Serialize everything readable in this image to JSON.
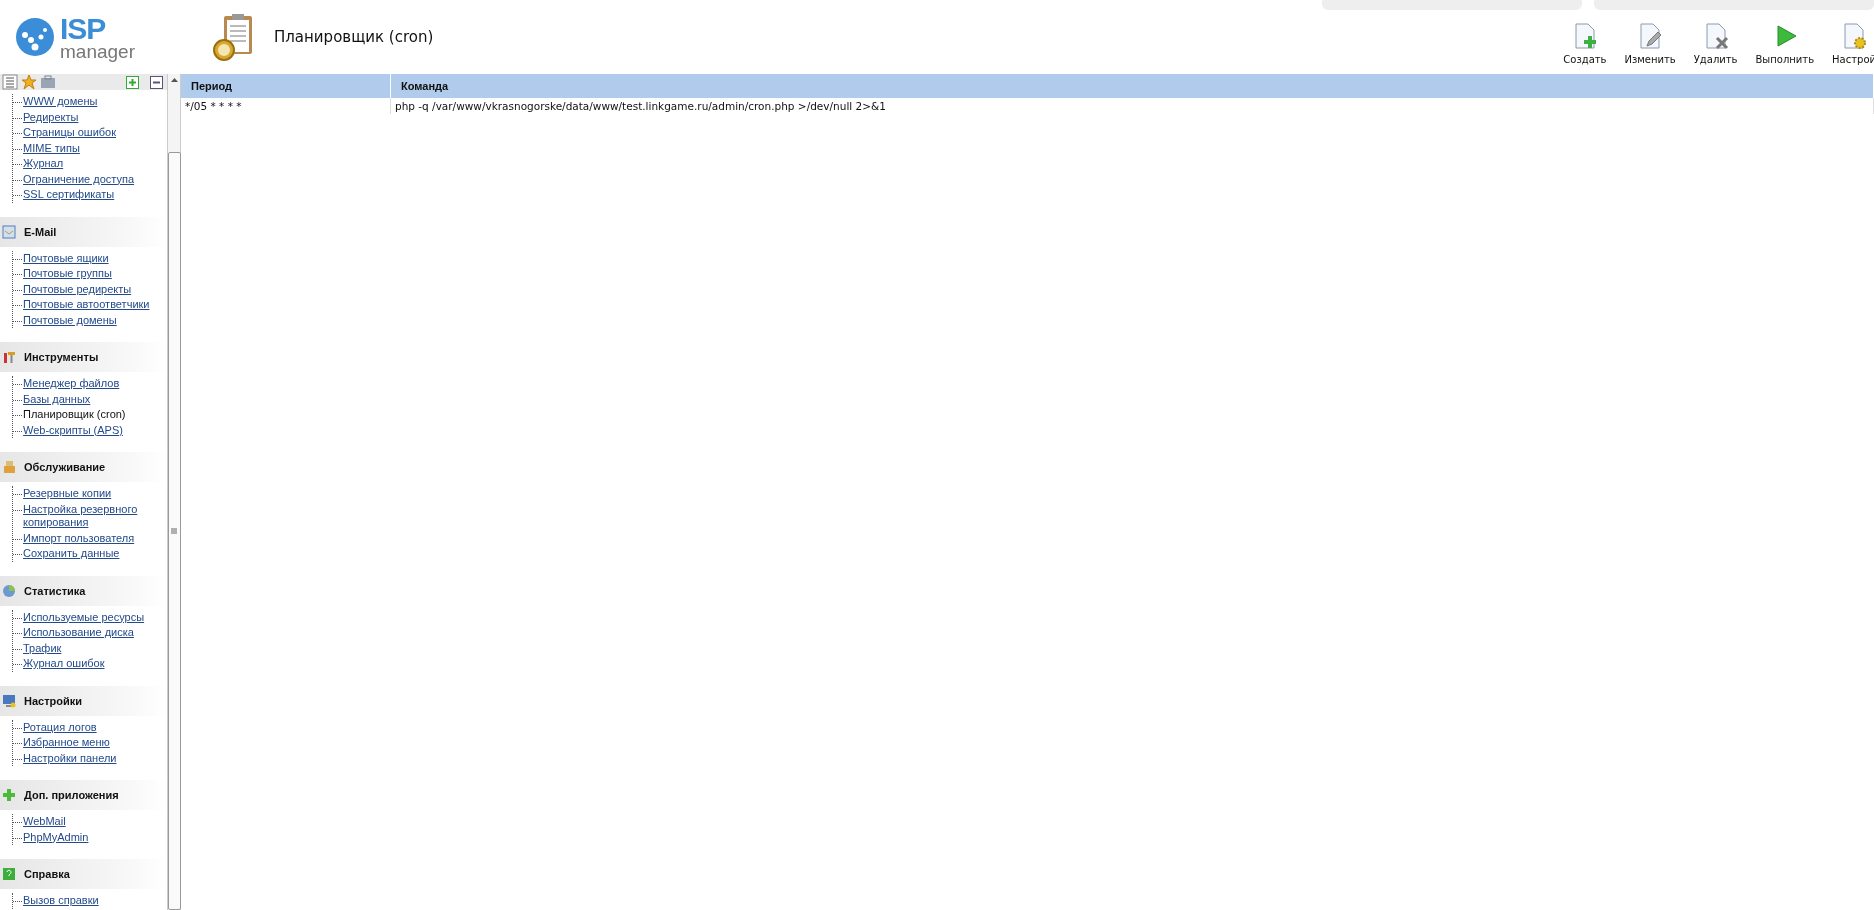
{
  "header": {
    "logo": {
      "brand": "ISP",
      "sub": "manager"
    },
    "title": "Планировщик (cron)"
  },
  "toolbar": [
    {
      "label": "Создать",
      "kind": "create"
    },
    {
      "label": "Изменить",
      "kind": "edit"
    },
    {
      "label": "Удалить",
      "kind": "delete"
    },
    {
      "label": "Выполнить",
      "kind": "run"
    },
    {
      "label": "Настрой",
      "kind": "settings"
    }
  ],
  "sidebar": {
    "sections": [
      {
        "items": [
          {
            "label": "WWW домены",
            "selected": false
          },
          {
            "label": "Редиректы",
            "selected": false
          },
          {
            "label": "Страницы ошибок",
            "selected": false
          },
          {
            "label": "MIME типы",
            "selected": false
          },
          {
            "label": "Журнал",
            "selected": false
          },
          {
            "label": "Ограничение доступа",
            "selected": false
          },
          {
            "label": "SSL сертификаты",
            "selected": false
          }
        ]
      },
      {
        "kind": "mail",
        "title": "E-Mail",
        "items": [
          {
            "label": "Почтовые ящики",
            "selected": false
          },
          {
            "label": "Почтовые группы",
            "selected": false
          },
          {
            "label": "Почтовые редиректы",
            "selected": false
          },
          {
            "label": "Почтовые автоответчики",
            "selected": false
          },
          {
            "label": "Почтовые домены",
            "selected": false
          }
        ]
      },
      {
        "kind": "tools",
        "title": "Инструменты",
        "items": [
          {
            "label": "Менеджер файлов",
            "selected": false
          },
          {
            "label": "Базы данных",
            "selected": false
          },
          {
            "label": "Планировщик (cron)",
            "selected": true
          },
          {
            "label": "Web-скрипты (APS)",
            "selected": false
          }
        ]
      },
      {
        "kind": "service",
        "title": "Обслуживание",
        "items": [
          {
            "label": "Резервные копии",
            "selected": false
          },
          {
            "label": "Настройка резервного копирования",
            "selected": false
          },
          {
            "label": "Импорт пользователя",
            "selected": false
          },
          {
            "label": "Сохранить данные",
            "selected": false
          }
        ]
      },
      {
        "kind": "stats",
        "title": "Статистика",
        "items": [
          {
            "label": "Используемые ресурсы",
            "selected": false
          },
          {
            "label": "Использование диска",
            "selected": false
          },
          {
            "label": "Трафик",
            "selected": false
          },
          {
            "label": "Журнал ошибок",
            "selected": false
          }
        ]
      },
      {
        "kind": "settings",
        "title": "Настройки",
        "items": [
          {
            "label": "Ротация логов",
            "selected": false
          },
          {
            "label": "Избранное меню",
            "selected": false
          },
          {
            "label": "Настройки панели",
            "selected": false
          }
        ]
      },
      {
        "kind": "apps",
        "title": "Доп. приложения",
        "items": [
          {
            "label": "WebMail",
            "selected": false
          },
          {
            "label": "PhpMyAdmin",
            "selected": false
          }
        ]
      },
      {
        "kind": "help",
        "title": "Справка",
        "items": [
          {
            "label": "Вызов справки",
            "selected": false
          }
        ]
      }
    ]
  },
  "table": {
    "columns": [
      "Период",
      "Команда"
    ],
    "rows": [
      [
        "*/05 * * * *",
        "php -q /var/www/vkrasnogorske/data/www/test.linkgame.ru/admin/cron.php >/dev/null 2>&1"
      ]
    ]
  }
}
